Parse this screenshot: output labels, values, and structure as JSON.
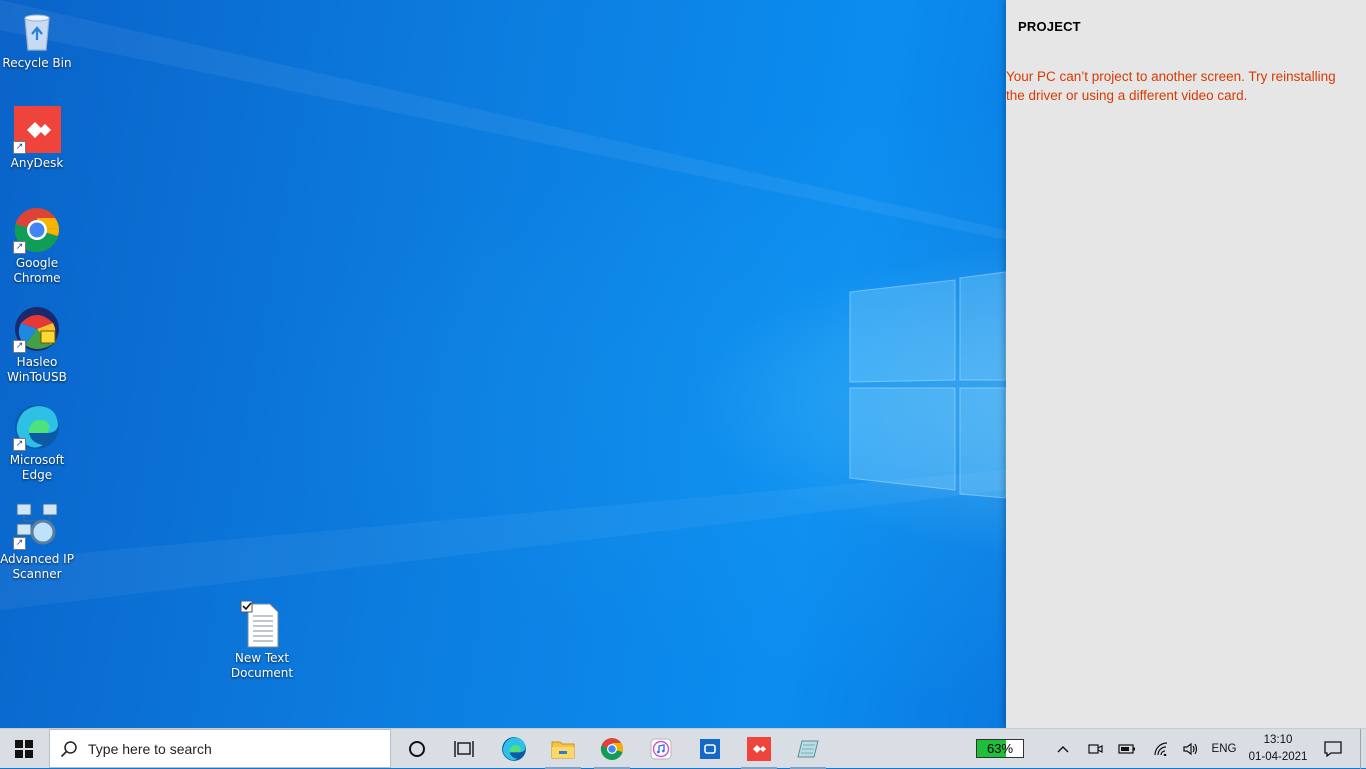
{
  "desktop": {
    "icons": [
      {
        "label_line1": "Recycle Bin",
        "label_line2": "",
        "icon": "recycle-bin-icon"
      },
      {
        "label_line1": "AnyDesk",
        "label_line2": "",
        "icon": "anydesk-icon"
      },
      {
        "label_line1": "Google",
        "label_line2": "Chrome",
        "icon": "chrome-icon"
      },
      {
        "label_line1": "Hasleo",
        "label_line2": "WinToUSB",
        "icon": "wintousb-icon"
      },
      {
        "label_line1": "Microsoft",
        "label_line2": "Edge",
        "icon": "edge-icon"
      },
      {
        "label_line1": "Advanced IP",
        "label_line2": "Scanner",
        "icon": "advanced-ip-scanner-icon"
      },
      {
        "label_line1": "New Text",
        "label_line2": "Document",
        "icon": "text-document-icon"
      }
    ]
  },
  "project_panel": {
    "title": "PROJECT",
    "error_message": "Your PC can’t project to another screen. Try reinstalling the driver or using a different video card.",
    "error_color": "#d83b01"
  },
  "taskbar": {
    "search_placeholder": "Type here to search",
    "pinned": [
      "cortana-icon",
      "task-view-icon",
      "edge-icon",
      "file-explorer-icon",
      "chrome-icon",
      "itunes-icon",
      "app-store-icon",
      "anydesk-icon",
      "notepad-icon"
    ],
    "battery_percent": "63%",
    "battery_level": 0.63,
    "battery_color": "#1fbf3c",
    "language": "ENG",
    "time": "13:10",
    "date": "01-04-2021"
  }
}
